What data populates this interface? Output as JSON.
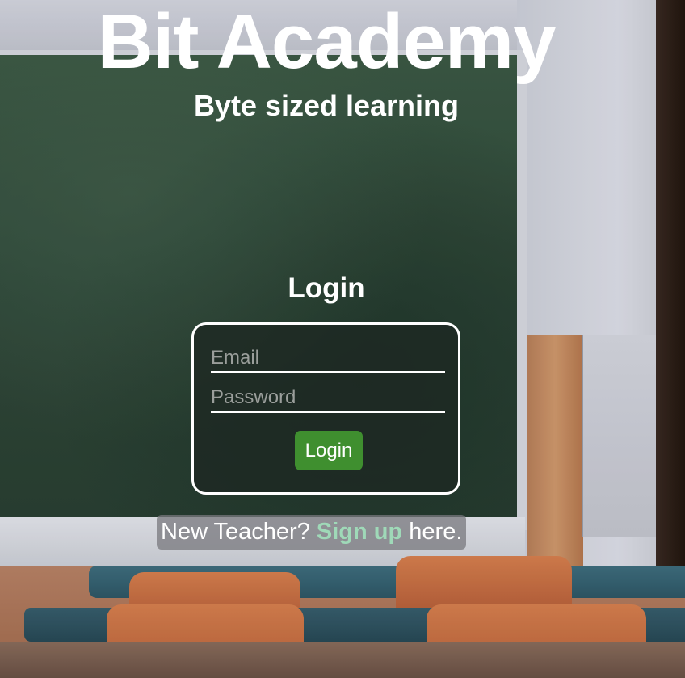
{
  "header": {
    "title": "Bit Academy",
    "subtitle": "Byte sized learning"
  },
  "login": {
    "heading": "Login",
    "email_placeholder": "Email",
    "password_placeholder": "Password",
    "submit_label": "Login"
  },
  "signup": {
    "prefix": "New Teacher? ",
    "link_label": "Sign up",
    "suffix": " here."
  },
  "colors": {
    "primary_button": "#3f8f2f",
    "link": "#9fd9b8",
    "text": "#ffffff"
  },
  "background": {
    "description_icon": "classroom-photo"
  }
}
